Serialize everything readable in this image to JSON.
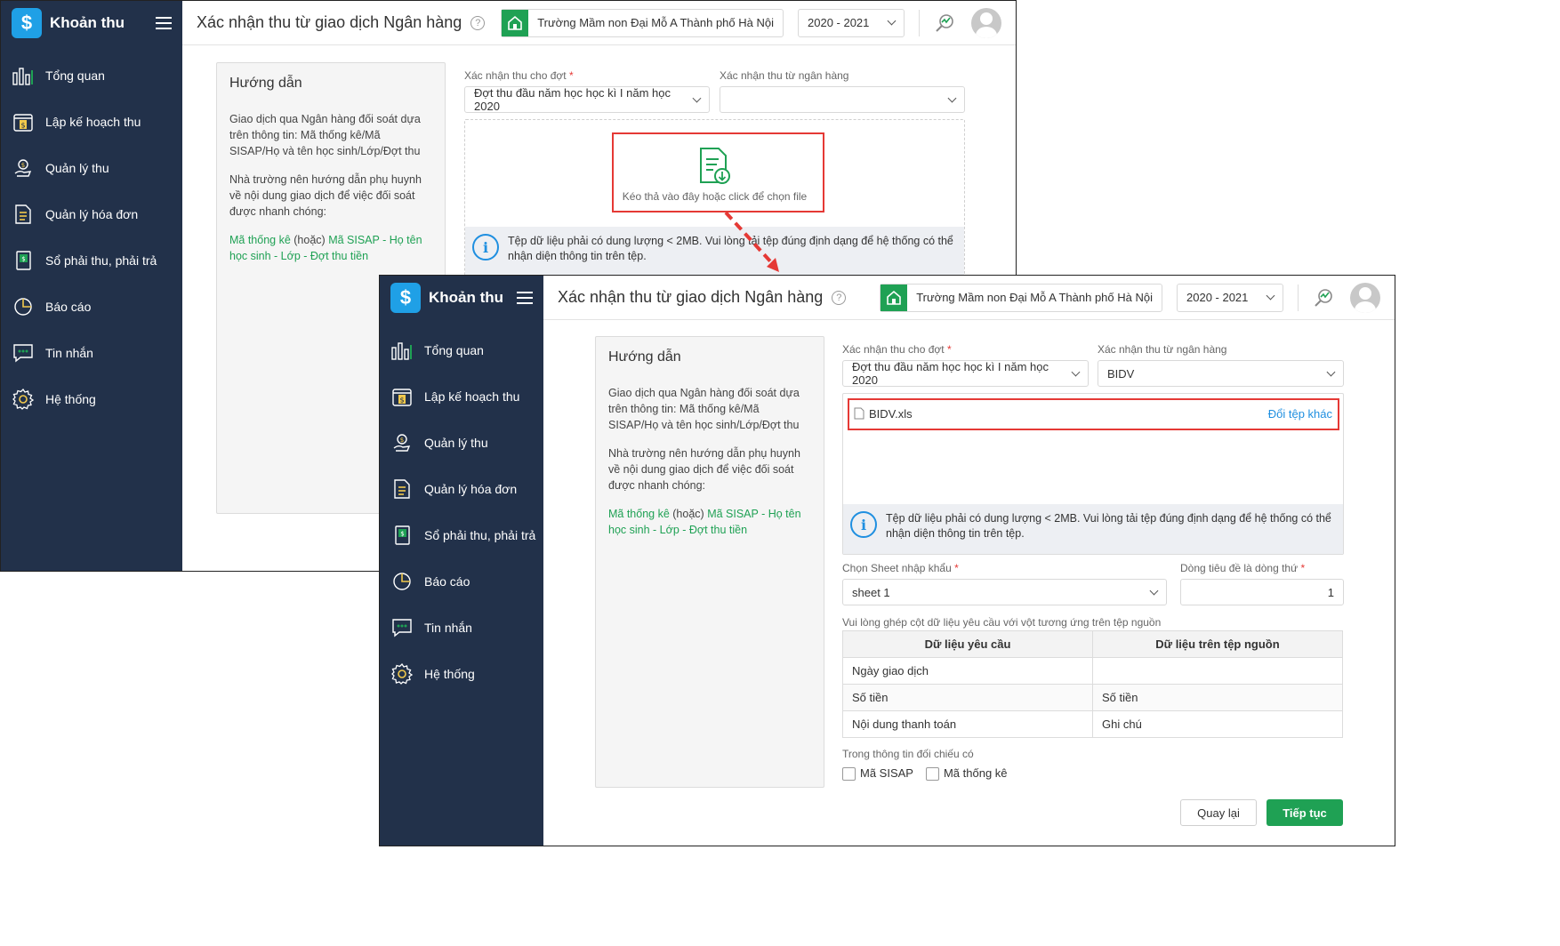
{
  "app": {
    "name": "Khoản thu",
    "logo_symbol": "$",
    "accent": "#1fa154",
    "sidebar_bg": "#22314a"
  },
  "nav": [
    {
      "label": "Tổng quan",
      "icon": "bar-chart-icon"
    },
    {
      "label": "Lập kế hoạch thu",
      "icon": "calendar-money-icon"
    },
    {
      "label": "Quản lý thu",
      "icon": "hand-money-icon"
    },
    {
      "label": "Quản lý hóa đơn",
      "icon": "invoice-icon"
    },
    {
      "label": "Sổ phải thu, phải trả",
      "icon": "ledger-icon"
    },
    {
      "label": "Báo cáo",
      "icon": "pie-chart-icon"
    },
    {
      "label": "Tin nhắn",
      "icon": "message-icon"
    },
    {
      "label": "Hệ thống",
      "icon": "gear-icon"
    }
  ],
  "header": {
    "title": "Xác nhận thu từ giao dịch Ngân hàng",
    "help": "?",
    "school": "Trường Mầm non Đại Mỗ A Thành phố Hà Nội",
    "year": "2020 - 2021"
  },
  "guide": {
    "title": "Hướng dẫn",
    "p1": "Giao dịch qua Ngân hàng đối soát dựa trên thông tin: Mã thống kê/Mã SISAP/Họ và tên học sinh/Lớp/Đợt thu",
    "p2": "Nhà trường nên hướng dẫn phụ huynh về nội dung giao dịch để việc đối soát được nhanh chóng:",
    "p3_a": "Mã thống kê",
    "p3_b": " (hoặc) ",
    "p3_c": "Mã SISAP - Họ tên học sinh - Lớp - Đợt thu tiền"
  },
  "form": {
    "batch_label": "Xác nhận thu cho đợt",
    "required_mark": "*",
    "batch_value": "Đợt thu đầu năm học học kì I năm học 2020",
    "bank_label": "Xác nhận thu từ ngân hàng",
    "bank_value_empty": "",
    "bank_value": "BIDV",
    "drop_text": "Kéo thả vào đây hoặc click để chọn file",
    "info_symbol": "i",
    "info_text": "Tệp dữ liệu phải có dung lượng < 2MB. Vui lòng tải tệp đúng định dạng để hệ thống có thể nhận diện thông tin trên tệp.",
    "file_name": "BIDV.xls",
    "change_file": "Đổi tệp khác",
    "sheet_label": "Chọn Sheet nhập khẩu",
    "sheet_value": "sheet 1",
    "header_row_label": "Dòng tiêu đề là dòng thứ",
    "header_row_value": "1",
    "map_label": "Vui lòng ghép cột dữ liệu yêu cầu với vột tương ứng trên tệp nguồn",
    "map_headers": [
      "Dữ liệu yêu cầu",
      "Dữ liệu trên tệp nguồn"
    ],
    "map_rows": [
      [
        "Ngày giao dịch",
        ""
      ],
      [
        "Số tiền",
        "Số tiền"
      ],
      [
        "Nội dung thanh toán",
        "Ghi chú"
      ]
    ],
    "compare_label": "Trong thông tin đối chiếu có",
    "cb_sisap": "Mã SISAP",
    "cb_stat": "Mã thống kê",
    "back_btn": "Quay lại",
    "next_btn": "Tiếp tục"
  }
}
